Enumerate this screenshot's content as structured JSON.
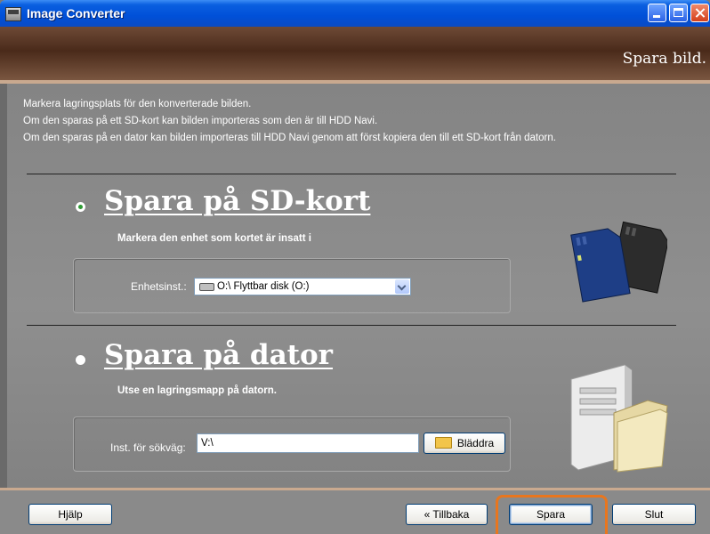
{
  "window": {
    "title": "Image Converter"
  },
  "banner": {
    "title": "Spara bild."
  },
  "instructions": [
    "Markera lagringsplats för den konverterade bilden.",
    "Om den sparas på ett SD-kort kan bilden importeras som den är till HDD Navi.",
    "Om den sparas på en dator kan bilden importeras till HDD Navi genom att först kopiera den till ett SD-kort från datorn."
  ],
  "sd_option": {
    "title": "Spara på SD-kort",
    "subtitle": "Markera den enhet som kortet är insatt i",
    "selected": true,
    "device_label": "Enhetsinst.:",
    "device_value": "O:\\ Flyttbar disk (O:)"
  },
  "pc_option": {
    "title": "Spara på dator",
    "subtitle": "Utse en lagringsmapp på datorn.",
    "selected": false,
    "path_label": "Inst. för sökväg:",
    "path_value": "V:\\",
    "browse_label": "Bläddra"
  },
  "footer": {
    "help_label": "Hjälp",
    "back_label": "« Tillbaka",
    "save_label": "Spara",
    "exit_label": "Slut"
  },
  "colors": {
    "titlebar": "#0050d8",
    "banner": "#4a2a1a",
    "highlight": "#e8761e",
    "radio_selected": "#2d9a33"
  }
}
